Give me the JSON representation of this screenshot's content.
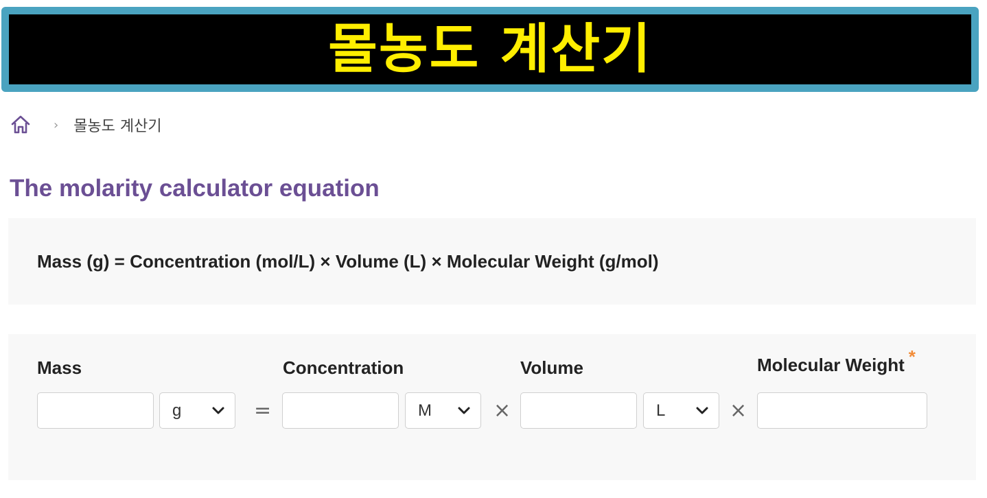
{
  "banner": {
    "title": "몰농도 계산기"
  },
  "breadcrumb": {
    "current": "몰농도 계산기",
    "separator": "›"
  },
  "section": {
    "title": "The molarity calculator equation"
  },
  "equation": {
    "text": "Mass (g) = Concentration (mol/L) × Volume (L) × Molecular Weight (g/mol)"
  },
  "calculator": {
    "mass": {
      "label": "Mass",
      "value": "",
      "unit": "g"
    },
    "equals": "=",
    "concentration": {
      "label": "Concentration",
      "value": "",
      "unit": "M"
    },
    "times1": "×",
    "volume": {
      "label": "Volume",
      "value": "",
      "unit": "L"
    },
    "times2": "×",
    "molecular_weight": {
      "label": "Molecular Weight",
      "required_mark": "*",
      "value": ""
    }
  },
  "colors": {
    "banner_bg": "#000000",
    "banner_border": "#4aa3c0",
    "banner_text": "#ffee00",
    "title": "#6b4f94",
    "required": "#f28c38"
  },
  "icons": {
    "home": "home-icon",
    "select": "chevron-down-icon"
  }
}
